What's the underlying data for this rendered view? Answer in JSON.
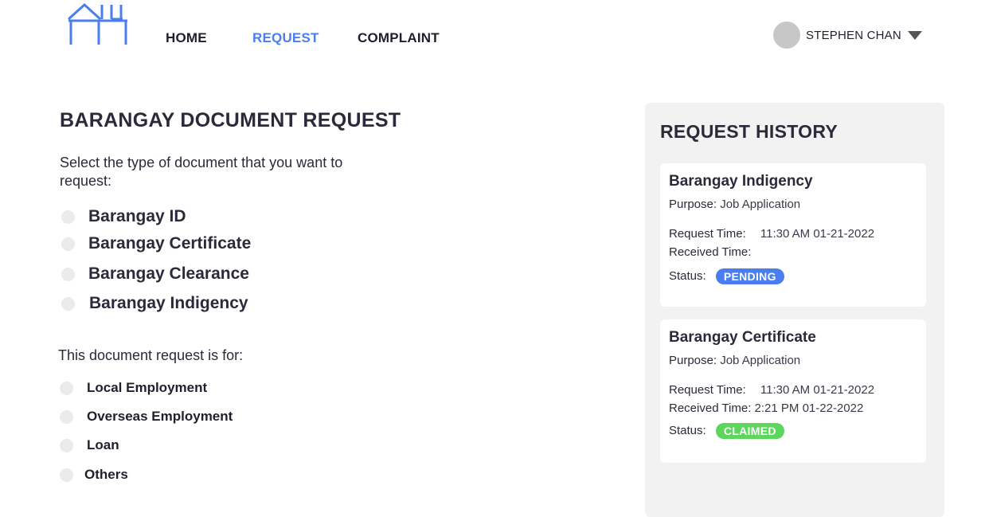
{
  "nav": {
    "items": [
      {
        "label": "HOME",
        "active": false
      },
      {
        "label": "REQUEST",
        "active": true
      },
      {
        "label": "COMPLAINT",
        "active": false
      }
    ],
    "user_name": "STEPHEN CHAN"
  },
  "colors": {
    "accent": "#4a7ef0",
    "pending": "#4a7ef0",
    "claimed": "#5cd65c"
  },
  "main": {
    "title": "BARANGAY DOCUMENT REQUEST",
    "prompt": "Select the type of document that you want to request:",
    "documents": [
      "Barangay ID",
      "Barangay Certificate",
      "Barangay Clearance",
      "Barangay Indigency"
    ],
    "purpose_prompt": "This document request is for:",
    "purposes": [
      "Local Employment",
      "Overseas Employment",
      "Loan",
      "Others"
    ]
  },
  "history": {
    "title": "REQUEST HISTORY",
    "cards": [
      {
        "title": "Barangay Indigency",
        "purpose_key": "Purpose:",
        "purpose": "Job Application",
        "request_key": "Request Time:",
        "request_time": "11:30 AM 01-21-2022",
        "received_key": "Received Time:",
        "received_time": "",
        "status_key": "Status:",
        "status": "PENDING"
      },
      {
        "title": "Barangay Certificate",
        "purpose_key": "Purpose:",
        "purpose": "Job Application",
        "request_key": "Request Time:",
        "request_time": "11:30 AM 01-21-2022",
        "received_key": "Received Time:",
        "received_time": "2:21 PM  01-22-2022",
        "status_key": "Status:",
        "status": "CLAIMED"
      }
    ]
  }
}
